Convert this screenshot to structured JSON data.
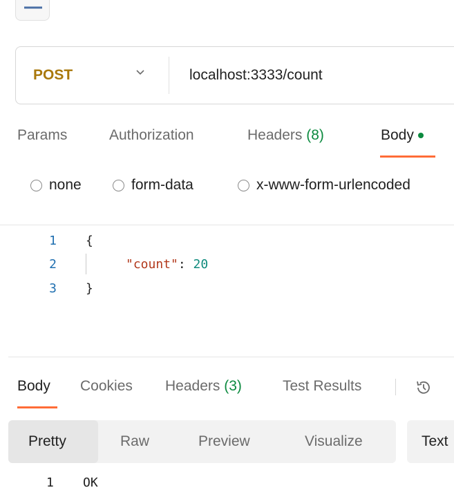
{
  "request": {
    "method": "POST",
    "url": "localhost:3333/count"
  },
  "request_tabs": {
    "params": "Params",
    "authorization": "Authorization",
    "headers": "Headers",
    "headers_count": "(8)",
    "body": "Body"
  },
  "body_modes": {
    "none": "none",
    "form_data": "form-data",
    "urlencoded": "x-www-form-urlencoded"
  },
  "editor": {
    "lines": [
      {
        "n": "1",
        "text": "{"
      },
      {
        "n": "2",
        "key": "\"count\"",
        "colon": ": ",
        "value": "20"
      },
      {
        "n": "3",
        "text": "}"
      }
    ]
  },
  "response_tabs": {
    "body": "Body",
    "cookies": "Cookies",
    "headers": "Headers",
    "headers_count": "(3)",
    "test_results": "Test Results"
  },
  "response_view": {
    "pretty": "Pretty",
    "raw": "Raw",
    "preview": "Preview",
    "visualize": "Visualize",
    "format": "Text"
  },
  "response_body": {
    "line_number": "1",
    "text": "OK"
  },
  "colors": {
    "method": "#a9780b",
    "accent": "#ff6c37",
    "count_green": "#0c8a3f"
  }
}
